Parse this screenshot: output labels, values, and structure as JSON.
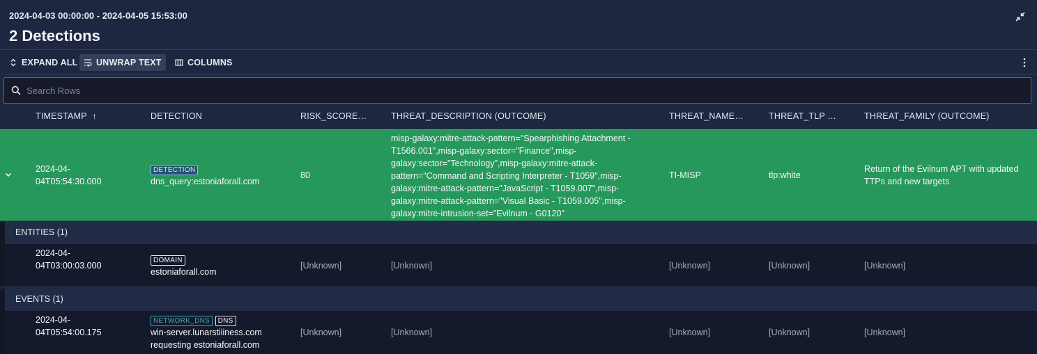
{
  "header": {
    "range": "2024-04-03 00:00:00 - 2024-04-05 15:53:00",
    "title": "2 Detections"
  },
  "toolbar": {
    "expand_all": "EXPAND ALL",
    "unwrap_text": "UNWRAP TEXT",
    "columns": "COLUMNS"
  },
  "search": {
    "placeholder": "Search Rows"
  },
  "columns": {
    "timestamp": "TIMESTAMP",
    "sort_arrow": "↑",
    "detection": "DETECTION",
    "risk": "RISK_SCORE…",
    "threat_desc": "THREAT_DESCRIPTION (OUTCOME)",
    "threat_name": "THREAT_NAME…",
    "threat_tlp": "THREAT_TLP …",
    "threat_family": "THREAT_FAMILY (OUTCOME)"
  },
  "detection_row": {
    "timestamp_l1": "2024-04-",
    "timestamp_l2": "04T05:54:30.000",
    "tag": "DETECTION",
    "name": "dns_query:estoniaforall.com",
    "risk": "80",
    "desc": [
      "misp-galaxy:mitre-attack-pattern=\"Spearphishing Attachment -",
      "T1566.001\",misp-galaxy:sector=\"Finance\",misp-",
      "galaxy:sector=\"Technology\",misp-galaxy:mitre-attack-",
      "pattern=\"Command and Scripting Interpreter - T1059\",misp-",
      "galaxy:mitre-attack-pattern=\"JavaScript - T1059.007\",misp-",
      "galaxy:mitre-attack-pattern=\"Visual Basic - T1059.005\",misp-",
      "galaxy:mitre-intrusion-set=\"Evilnum - G0120\""
    ],
    "threat_name": "TI-MISP",
    "threat_tlp": "tlp:white",
    "threat_family_l1": "Return of the Evilnum APT with updated",
    "threat_family_l2": "TTPs and new targets"
  },
  "entities": {
    "header": "ENTITIES (1)",
    "row": {
      "timestamp_l1": "2024-04-",
      "timestamp_l2": "04T03:00:03.000",
      "tag": "DOMAIN",
      "name": "estoniaforall.com",
      "risk": "[Unknown]",
      "desc": "[Unknown]",
      "threat_name": "[Unknown]",
      "threat_tlp": "[Unknown]",
      "threat_family": "[Unknown]"
    }
  },
  "events": {
    "header": "EVENTS (1)",
    "row": {
      "timestamp_l1": "2024-04-",
      "timestamp_l2": "04T05:54:00.175",
      "tag1": "NETWORK_DNS",
      "tag2": "DNS",
      "name_l1": "win-server.lunarstiiiness.com",
      "name_l2": "requesting estoniaforall.com",
      "risk": "[Unknown]",
      "desc": "[Unknown]",
      "threat_name": "[Unknown]",
      "threat_tlp": "[Unknown]",
      "threat_family": "[Unknown]"
    }
  },
  "icons": [
    "collapse-icon",
    "expand-all-icon",
    "unwrap-text-icon",
    "columns-icon",
    "kebab-menu-icon",
    "search-icon",
    "chevron-down-icon"
  ]
}
